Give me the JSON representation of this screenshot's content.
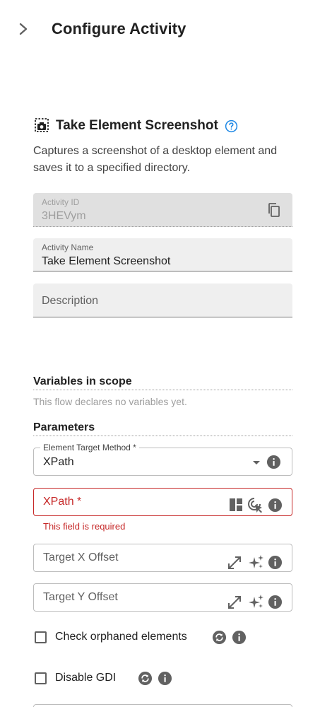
{
  "header": {
    "title": "Configure Activity",
    "collapse_icon": "chevron-right-icon"
  },
  "activity": {
    "title": "Take Element Screenshot",
    "icon": "screenshot-camera-icon",
    "help_icon": "help-circle-icon",
    "description": "Captures a screenshot of a desktop element and saves it to a specified directory."
  },
  "fields": {
    "activity_id": {
      "label": "Activity ID",
      "value": "3HEVym",
      "icon": "copy-icon"
    },
    "activity_name": {
      "label": "Activity Name",
      "value": "Take Element Screenshot"
    },
    "description": {
      "placeholder": "Description"
    }
  },
  "variables": {
    "title": "Variables in scope",
    "note": "This flow declares no variables yet."
  },
  "parameters": {
    "title": "Parameters",
    "element_target_method": {
      "label": "Element Target Method *",
      "value": "XPath"
    },
    "xpath": {
      "label": "XPath *",
      "error": "This field is required"
    },
    "target_x_offset": {
      "placeholder": "Target X Offset"
    },
    "target_y_offset": {
      "placeholder": "Target Y Offset"
    },
    "check_orphaned": {
      "label": "Check orphaned elements",
      "checked": false
    },
    "disable_gdi": {
      "label": "Disable GDI",
      "checked": false
    }
  },
  "colors": {
    "error": "#c62828",
    "accent": "#1e88e5",
    "icon": "#616161"
  }
}
